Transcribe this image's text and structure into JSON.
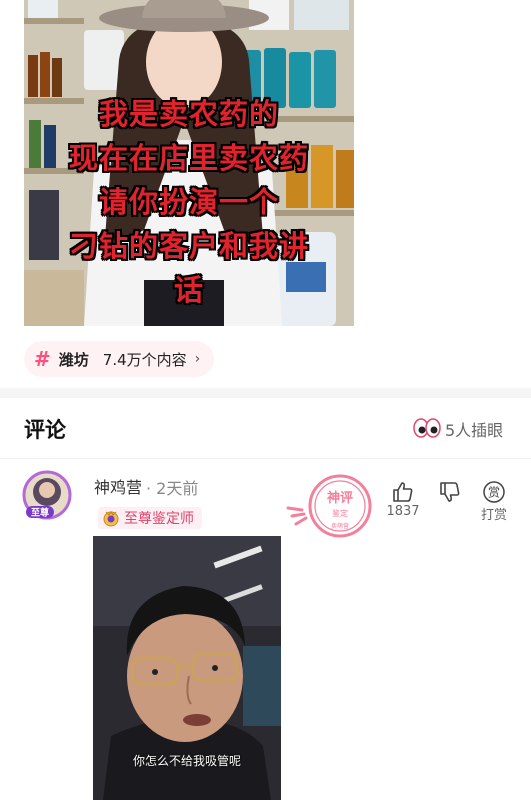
{
  "post": {
    "caption_lines": [
      "我是卖农药的",
      "现在在店里卖农药",
      "请你扮演一个",
      "刁钻的客户和我讲",
      "话"
    ]
  },
  "topic": {
    "hash": "#",
    "name": "潍坊",
    "count": "7.4万个内容",
    "chevron": "›"
  },
  "comments": {
    "title": "评论",
    "viewers": "5人插眼",
    "eyes_icon": "eyes-icon"
  },
  "comment": {
    "username": "神鸡营",
    "time": "· 2天前",
    "avatar_badge": "至尊",
    "badge": "至尊鉴定师",
    "stamp": {
      "line1": "神评",
      "line2": "鉴定",
      "line3": "卖萌营"
    },
    "like_count": "1837",
    "reward_glyph": "赏",
    "reward_label": "打赏",
    "meme_subtitle": "你怎么不给我吸管呢"
  },
  "colors": {
    "accent": "#ff4f7a",
    "caption": "#e0232c",
    "stamp": "#f06a8a"
  }
}
